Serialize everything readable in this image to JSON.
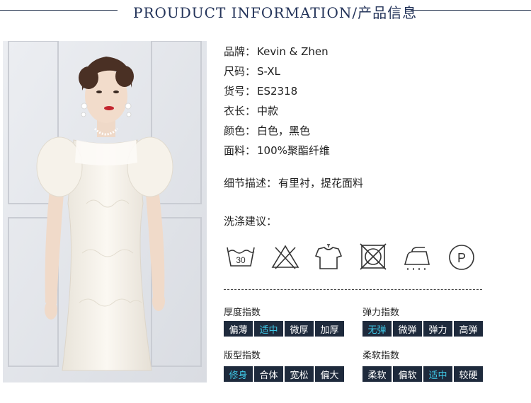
{
  "header": {
    "title": "PROUDUCT INFORMATION/产品信息"
  },
  "product": {
    "brand_label": "品牌：",
    "brand_value": "Kevin & Zhen",
    "size_label": "尺码：",
    "size_value": "S-XL",
    "sku_label": "货号：",
    "sku_value": "ES2318",
    "length_label": "衣长：",
    "length_value": "中款",
    "color_label": "颜色：",
    "color_value": "白色，黑色",
    "fabric_label": "面料：",
    "fabric_value": "100%聚酯纤维",
    "detail_label": "细节描述：",
    "detail_value": "有里衬，提花面料"
  },
  "care": {
    "title": "洗涤建议：",
    "wash_temp": "30",
    "dry_clean_letter": "P",
    "icons": [
      "wash-30-icon",
      "no-bleach-icon",
      "hang-dry-icon",
      "no-tumble-dry-icon",
      "iron-icon",
      "dry-clean-p-icon"
    ]
  },
  "indices": {
    "thickness": {
      "title": "厚度指数",
      "options": [
        "偏薄",
        "适中",
        "微厚",
        "加厚"
      ],
      "selected": "适中"
    },
    "elasticity": {
      "title": "弹力指数",
      "options": [
        "无弹",
        "微弹",
        "弹力",
        "高弹"
      ],
      "selected": "无弹"
    },
    "fit": {
      "title": "版型指数",
      "options": [
        "修身",
        "合体",
        "宽松",
        "偏大"
      ],
      "selected": "修身"
    },
    "softness": {
      "title": "柔软指数",
      "options": [
        "柔软",
        "偏软",
        "适中",
        "较硬"
      ],
      "selected": "适中"
    }
  },
  "colors": {
    "header_text": "#24345a",
    "cell_bg": "#1e2a3c",
    "cell_text": "#ffffff",
    "cell_active_text": "#3ec6e4"
  }
}
